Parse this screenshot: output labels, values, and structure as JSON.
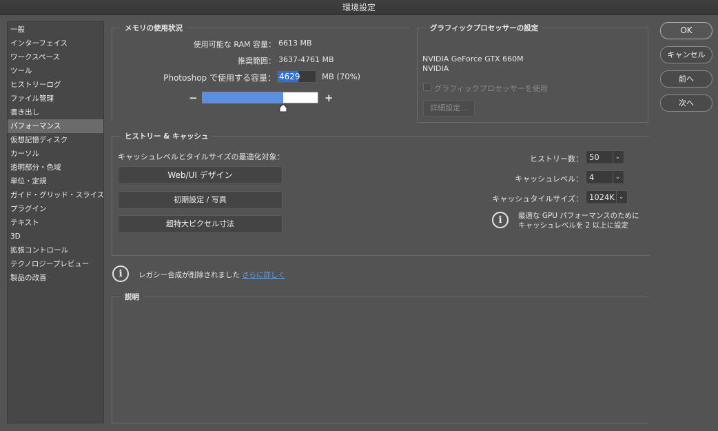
{
  "window": {
    "title": "環境設定"
  },
  "sidebar": {
    "items": [
      {
        "label": "一般"
      },
      {
        "label": "インターフェイス"
      },
      {
        "label": "ワークスペース"
      },
      {
        "label": "ツール"
      },
      {
        "label": "ヒストリーログ"
      },
      {
        "label": "ファイル管理"
      },
      {
        "label": "書き出し"
      },
      {
        "label": "パフォーマンス",
        "active": true
      },
      {
        "label": "仮想記憶ディスク"
      },
      {
        "label": "カーソル"
      },
      {
        "label": "透明部分・色域"
      },
      {
        "label": "単位・定規"
      },
      {
        "label": "ガイド・グリッド・スライス"
      },
      {
        "label": "プラグイン"
      },
      {
        "label": "テキスト"
      },
      {
        "label": "3D"
      },
      {
        "label": "拡張コントロール"
      },
      {
        "label": "テクノロジープレビュー"
      },
      {
        "label": "製品の改善"
      }
    ]
  },
  "memory": {
    "title": "メモリの使用状況",
    "available_label": "使用可能な RAM 容量：",
    "available_value": "6613 MB",
    "range_label": "推奨範囲：",
    "range_value": "3637-4761 MB",
    "use_label": "Photoshop で使用する容量：",
    "use_value": "4629",
    "use_unit": "MB (70%)",
    "slider_fraction": 0.7,
    "minus": "−",
    "plus": "+"
  },
  "gpu": {
    "title": "グラフィックプロセッサーの設定",
    "name": "NVIDIA GeForce GTX 660M",
    "vendor": "NVIDIA",
    "use_checkbox_label": "グラフィックプロセッサーを使用",
    "use_checked": false,
    "advanced_button": "詳細設定..."
  },
  "history_cache": {
    "title": "ヒストリー & キャッシュ",
    "optimize_label": "キャッシュレベルとタイルサイズの最適化対象：",
    "buttons": [
      "Web/UI デザイン",
      "初期設定 / 写真",
      "超特大ピクセル寸法"
    ],
    "history_states_label": "ヒストリー数：",
    "history_states_value": "50",
    "cache_levels_label": "キャッシュレベル：",
    "cache_levels_value": "4",
    "tile_size_label": "キャッシュタイルサイズ：",
    "tile_size_value": "1024K",
    "info_line1": "最適な GPU パフォーマンスのために",
    "info_line2": "キャッシュレベルを 2 以上に設定"
  },
  "legacy": {
    "text": "レガシー合成が削除されました",
    "link": "さらに詳しく"
  },
  "description": {
    "title": "説明"
  },
  "actions": {
    "ok": "OK",
    "cancel": "キャンセル",
    "prev": "前へ",
    "next": "次へ"
  },
  "colors": {
    "slider_fill": "#5b8fe0",
    "link": "#5aa0f0",
    "active_item": "#6b6b6b"
  }
}
